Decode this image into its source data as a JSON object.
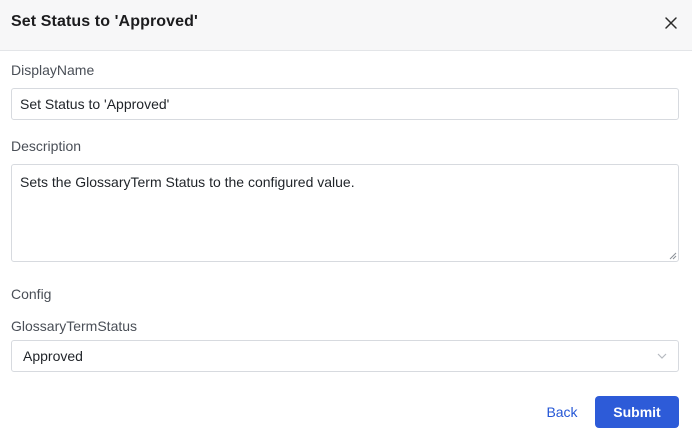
{
  "dialog": {
    "title": "Set Status to 'Approved'",
    "close_icon": "close-icon"
  },
  "form": {
    "display_name": {
      "label": "DisplayName",
      "value": "Set Status to 'Approved'"
    },
    "description": {
      "label": "Description",
      "value": "Sets the GlossaryTerm Status to the configured value."
    },
    "config": {
      "section_label": "Config",
      "glossary_term_status": {
        "label": "GlossaryTermStatus",
        "selected": "Approved",
        "icon": "chevron-down-icon"
      }
    }
  },
  "footer": {
    "back_label": "Back",
    "submit_label": "Submit"
  },
  "colors": {
    "accent": "#2d5bd8",
    "link": "#2557d6"
  }
}
